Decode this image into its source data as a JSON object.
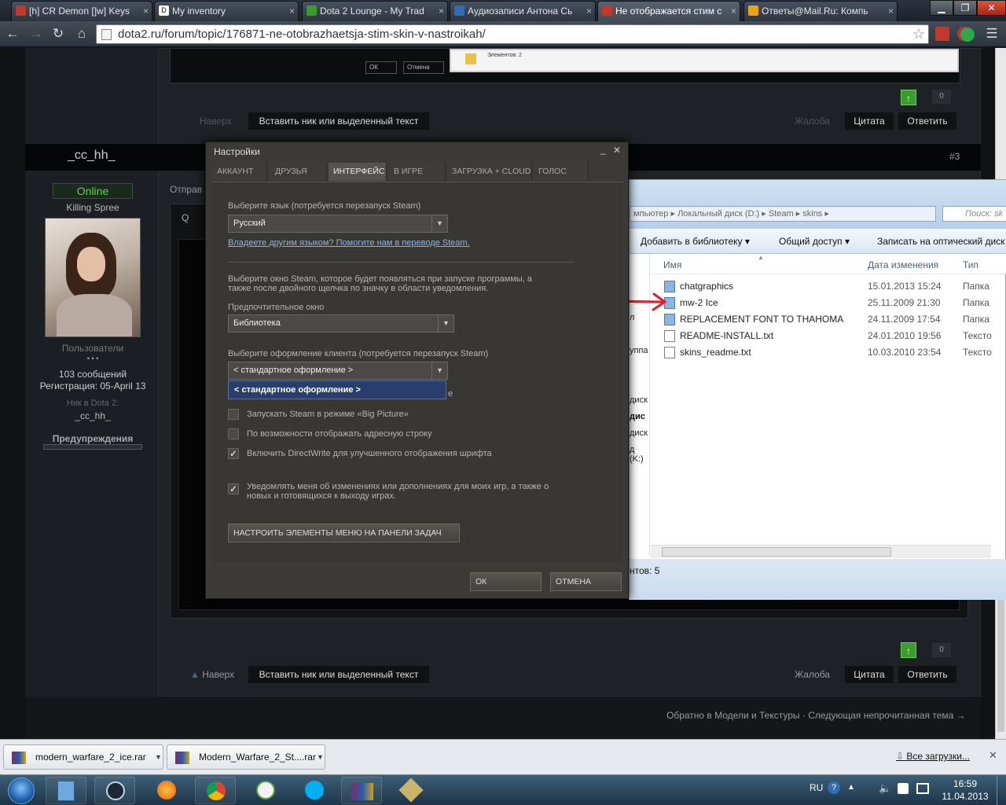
{
  "browser": {
    "tabs": [
      {
        "title": "[h] CR Demon []w] Keys",
        "color": "#c0392b"
      },
      {
        "title": "My inventory",
        "color": "#111111"
      },
      {
        "title": "Dota 2 Lounge - My Trad",
        "color": "#3a9b2e"
      },
      {
        "title": "Аудиозаписи Антона Сь",
        "color": "#2f6eb5"
      },
      {
        "title": "Не отображается стим с",
        "color": "#c0392b"
      },
      {
        "title": "Ответы@Mail.Ru: Компь",
        "color": "#e8a317"
      }
    ],
    "tab_close": "×",
    "url": "dota2.ru/forum/topic/176871-ne-otobrazhaetsja-stim-skin-v-nastroikah/",
    "win_min": "▁",
    "win_max": "❐",
    "win_close": "✕"
  },
  "screenshot_dialog": {
    "ok": "ОК",
    "cancel": "Отмена",
    "items": "Элементов: 2"
  },
  "forum": {
    "top": {
      "upvotes": "0",
      "nav_up": "Наверх",
      "insert": "Вставить ник или выделенный текст",
      "report": "Жалоба",
      "quote": "Цитата",
      "reply": "Ответить"
    },
    "post": {
      "username": "_cc_hh_",
      "post_number": "#3",
      "status": "Online",
      "rank": "Killing Spree",
      "group": "Пользователи",
      "dots": "• • •",
      "messages": "103 сообщений",
      "registration": "Регистрация: 05-April 13",
      "dota_nick_label": "Ник в Dota 2:",
      "dota_nick": "_cc_hh_",
      "warnings": "Предупреждения",
      "sent_prefix": "Отправ",
      "quote_prefix": "Q"
    },
    "bottom": {
      "upvotes": "0",
      "nav_up": "Наверх",
      "insert": "Вставить ник или выделенный текст",
      "report": "Жалоба",
      "quote": "Цитата",
      "reply": "Ответить"
    },
    "footer": {
      "back": "Обратно в Модели и Текстуры",
      "separator": "·",
      "next": "Следующая непрочитанная тема →"
    }
  },
  "explorer": {
    "path": [
      "мпьютер",
      "Локальный диск (D:)",
      "Steam",
      "skins"
    ],
    "search": "Поиск: sk",
    "toolbar": [
      "Добавить в библиотеку",
      "Общий доступ",
      "Записать на оптический диск"
    ],
    "columns": {
      "name": "Имя",
      "date": "Дата изменения",
      "type": "Тип"
    },
    "files": [
      {
        "name": "chatgraphics",
        "date": "15.01.2013 15:24",
        "type": "Папка",
        "icon": "folder-icon"
      },
      {
        "name": "mw-2 Ice",
        "date": "25.11.2009 21:30",
        "type": "Папка",
        "icon": "folder-icon"
      },
      {
        "name": "REPLACEMENT FONT TO THAHOMA",
        "date": "24.11.2009 17:54",
        "type": "Папка",
        "icon": "folder-icon"
      },
      {
        "name": "README-INSTALL.txt",
        "date": "24.01.2010 19:56",
        "type": "Тексто",
        "icon": "text-file-icon"
      },
      {
        "name": "skins_readme.txt",
        "date": "10.03.2010 23:54",
        "type": "Тексто",
        "icon": "text-file-icon"
      }
    ],
    "sidebar": [
      "л",
      "уппа",
      "диск",
      "дис",
      "диск",
      "д (K:)"
    ],
    "status": "нтов: 5"
  },
  "steam": {
    "title": "Настройки",
    "minimize": "_",
    "close": "✕",
    "tabs": [
      "АККАУНТ",
      "ДРУЗЬЯ",
      "ИНТЕРФЕЙС",
      "В ИГРЕ",
      "ЗАГРУЗКА + CLOUD",
      "ГОЛОС"
    ],
    "language_label": "Выберите язык (потребуется перезапуск Steam)",
    "language_value": "Русский",
    "translate_link": "Владеете другим языком? Помогите нам в переводе Steam.",
    "window_desc": "Выберите окно Steam, которое будет появляться при запуске программы, а также после двойного щелчка по значку в области уведомления.",
    "pref_window_label": "Предпочтительное окно",
    "pref_window_value": "Библиотека",
    "skin_label": "Выберите оформление клиента (потребуется перезапуск Steam)",
    "skin_value": "< стандартное оформление >",
    "skin_option": "< стандартное оформление >",
    "hidden_suffix": "е",
    "checkboxes": [
      {
        "label": "Запускать Steam в режиме «Big Picture»",
        "checked": false
      },
      {
        "label": "По возможности отображать адресную строку",
        "checked": false
      },
      {
        "label": "Включить DirectWrite для улучшенного отображения шрифта",
        "checked": true
      },
      {
        "label": "Уведомлять меня об изменениях или дополнениях для моих игр, а также о новых и готовящихся к выходу играх.",
        "checked": true
      }
    ],
    "check_mark": "✓",
    "taskbar_button": "НАСТРОИТЬ ЭЛЕМЕНТЫ МЕНЮ НА ПАНЕЛИ ЗАДАЧ",
    "ok": "ОК",
    "cancel": "ОТМЕНА"
  },
  "downloads": {
    "items": [
      "modern_warfare_2_ice.rar",
      "Modern_Warfare_2_St....rar"
    ],
    "all_downloads": "Все загрузки...",
    "close": "✕"
  },
  "taskbar": {
    "apps": [
      "start-orb",
      "file-explorer",
      "steam",
      "firefox",
      "chrome",
      "utorrent",
      "skype",
      "winrar",
      "tools"
    ],
    "language": "RU",
    "time": "16:59",
    "date": "11.04.2013"
  },
  "colors": {
    "online": "#5fd35f",
    "annotation": "#e0202a",
    "link": "#8fb3d9",
    "selection": "#2a3e6e"
  }
}
